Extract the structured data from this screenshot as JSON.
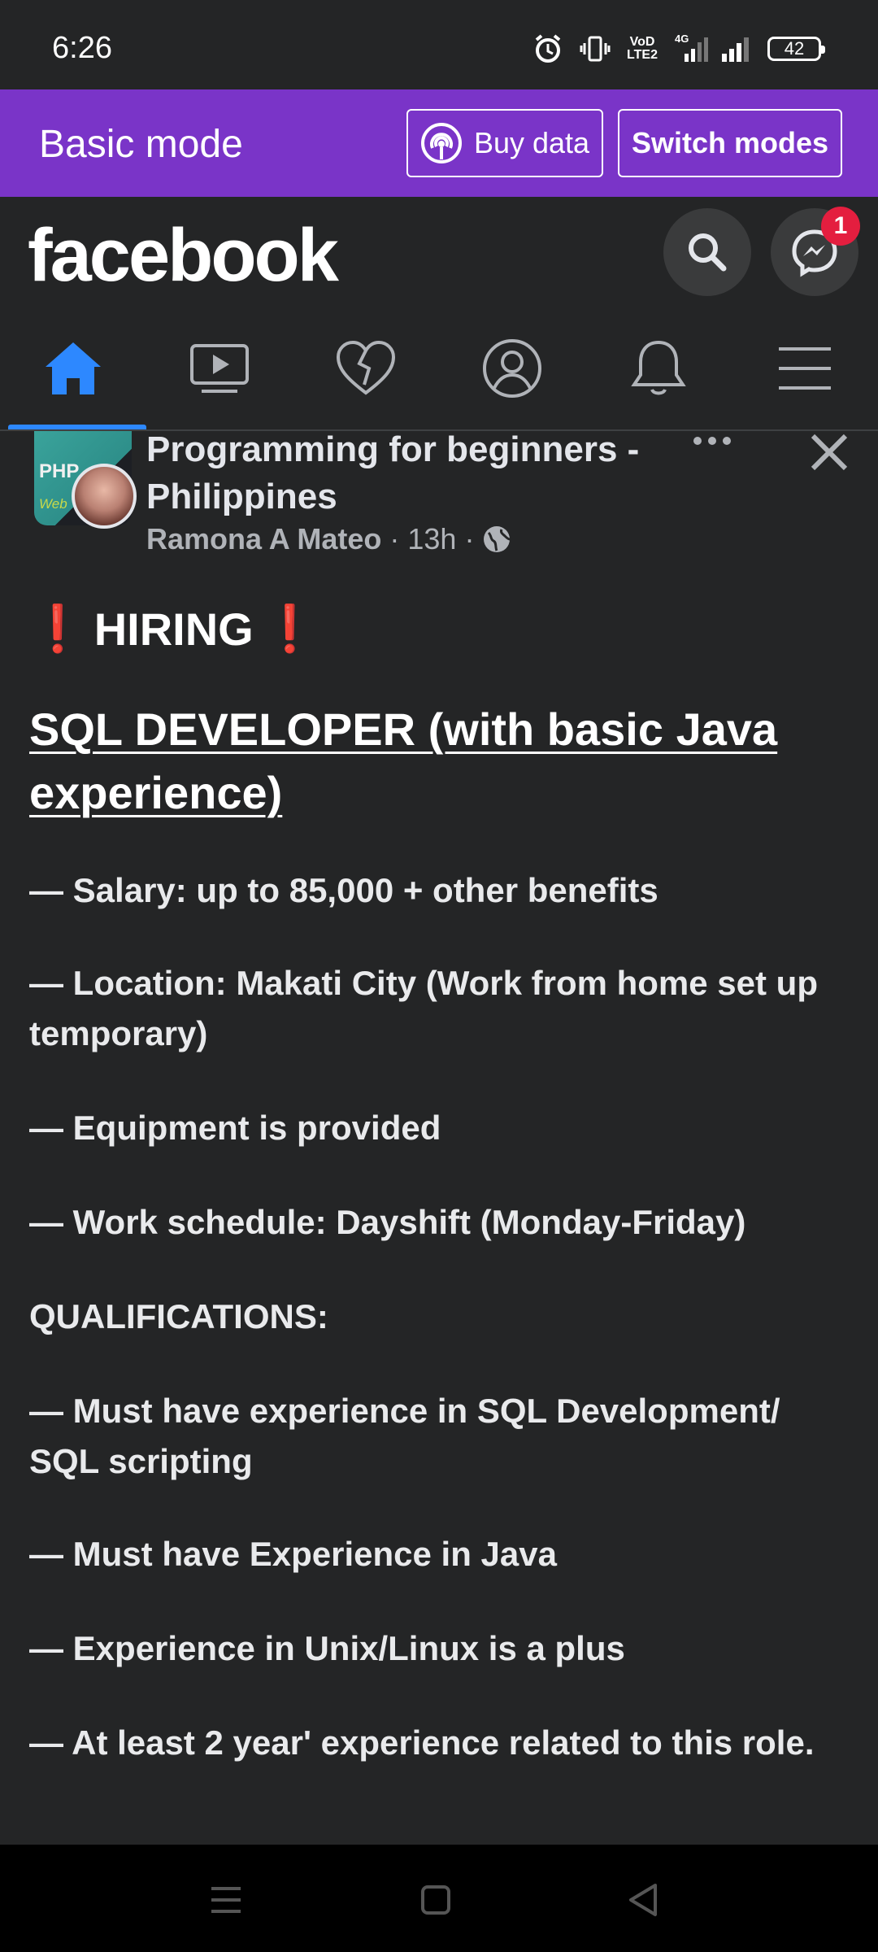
{
  "status_bar": {
    "time": "6:26",
    "volte_top": "VoD",
    "volte_bottom": "LTE2",
    "network": "4G",
    "battery": "42"
  },
  "mode_banner": {
    "title": "Basic mode",
    "buy_data_label": "Buy data",
    "switch_modes_label": "Switch modes",
    "color": "#7a34c8"
  },
  "header": {
    "logo": "facebook",
    "messenger_badge": "1"
  },
  "tabs": [
    {
      "name": "home",
      "active": true
    },
    {
      "name": "watch",
      "active": false
    },
    {
      "name": "dating",
      "active": false
    },
    {
      "name": "profile",
      "active": false
    },
    {
      "name": "notifications",
      "active": false
    },
    {
      "name": "menu",
      "active": false
    }
  ],
  "post": {
    "group_name": "Programming for beginners - Philippines",
    "avatar_text_1": "PHP",
    "avatar_text_2": "Web",
    "author": "Ramona A Mateo",
    "time": "13h",
    "separator": "·",
    "exclamation": "❗",
    "hiring": "HIRING",
    "job_title": "SQL DEVELOPER (with basic Java experience)",
    "lines": [
      "— Salary: up to 85,000 + other benefits",
      "— Location: Makati City (Work from home set up temporary)",
      "— Equipment is provided",
      "— Work schedule: Dayshift (Monday-Friday)",
      "QUALIFICATIONS:",
      "— Must have experience in SQL Development/ SQL scripting",
      "— Must have Experience in Java",
      "— Experience in Unix/Linux is a plus",
      "— At least 2 year' experience related to this role."
    ]
  },
  "colors": {
    "background": "#242526",
    "accent_blue": "#2d88ff",
    "badge_red": "#e41e3f"
  }
}
